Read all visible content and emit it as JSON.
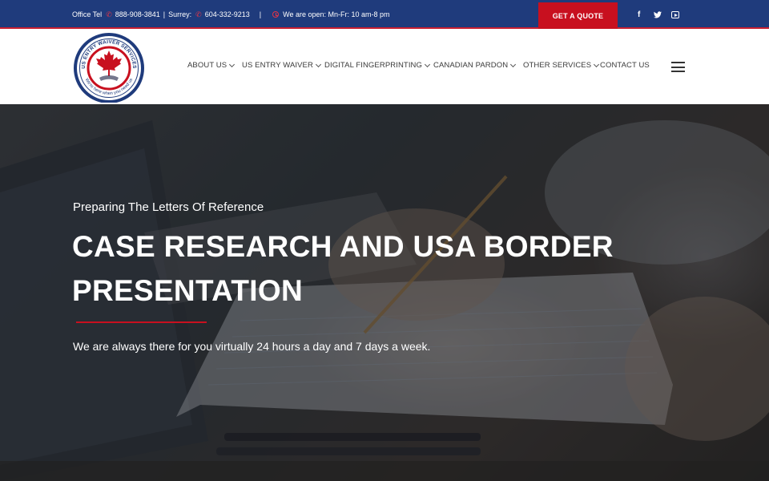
{
  "topbar": {
    "office_label": "Office Tel",
    "phone_icon": "phone-icon",
    "office_phone": "888-908-3841",
    "separator": "|",
    "surrey_label": "Surrey:",
    "surrey_phone": "604-332-9213",
    "divider": "|",
    "hours_icon": "clock-icon",
    "hours": "We are open: Mn-Fr: 10 am-8 pm",
    "quote_button": "GET A QUOTE",
    "social": [
      {
        "icon": "facebook-icon",
        "glyph": "f"
      },
      {
        "icon": "twitter-icon",
        "glyph": ""
      },
      {
        "icon": "youtube-icon",
        "glyph": ""
      }
    ]
  },
  "header": {
    "logo_text_top": "US ENTRY WAIVER SERVICES",
    "logo_text_bottom": "We're here when you need us",
    "nav": [
      {
        "label": "ABOUT US",
        "has_dropdown": true
      },
      {
        "label": "US ENTRY WAIVER",
        "has_dropdown": true
      },
      {
        "label": "DIGITAL FINGERPRINTING",
        "has_dropdown": true
      },
      {
        "label": "CANADIAN PARDON",
        "has_dropdown": true
      },
      {
        "label": "OTHER SERVICES",
        "has_dropdown": true
      },
      {
        "label": "CONTACT US",
        "has_dropdown": false
      }
    ],
    "menu_icon": "hamburger-menu-icon"
  },
  "hero": {
    "subtitle": "Preparing The Letters Of Reference",
    "title": "CASE RESEARCH AND USA BORDER PRESENTATION",
    "tagline": "We are always there for you virtually 24 hours a day and 7 days a week."
  },
  "colors": {
    "topbar_bg": "#1f3b7c",
    "accent_red": "#c8101f",
    "nav_text": "#3a3a3a"
  }
}
